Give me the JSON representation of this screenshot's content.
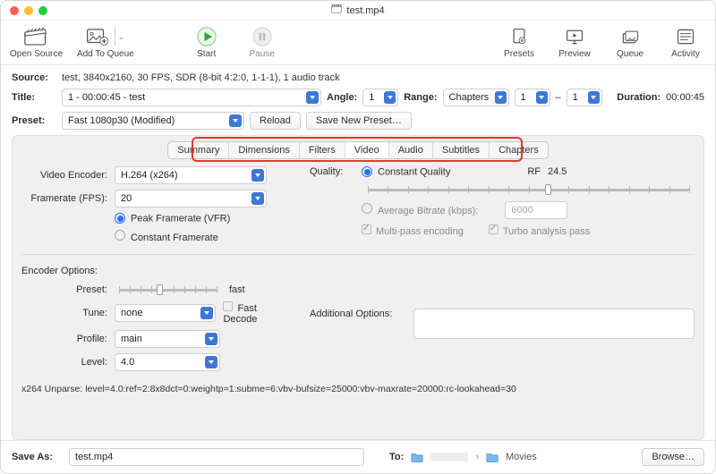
{
  "window": {
    "title": "test.mp4"
  },
  "toolbar": {
    "open_source": "Open Source",
    "add_to_queue": "Add To Queue",
    "start": "Start",
    "pause": "Pause",
    "presets": "Presets",
    "preview": "Preview",
    "queue": "Queue",
    "activity": "Activity"
  },
  "source": {
    "label": "Source:",
    "value": "test, 3840x2160, 30 FPS, SDR (8-bit 4:2:0, 1-1-1), 1 audio track"
  },
  "title_row": {
    "label": "Title:",
    "value": "1 - 00:00:45 - test",
    "angle_label": "Angle:",
    "angle": "1",
    "range_label": "Range:",
    "range_mode": "Chapters",
    "range_from": "1",
    "range_dash": "–",
    "range_to": "1",
    "duration_label": "Duration:",
    "duration": "00:00:45"
  },
  "preset_row": {
    "label": "Preset:",
    "value": "Fast 1080p30 (Modified)",
    "reload": "Reload",
    "save_new": "Save New Preset…"
  },
  "tabs": {
    "items": [
      "Summary",
      "Dimensions",
      "Filters",
      "Video",
      "Audio",
      "Subtitles",
      "Chapters"
    ],
    "active_index": 3
  },
  "video": {
    "encoder_label": "Video Encoder:",
    "encoder": "H.264 (x264)",
    "fps_label": "Framerate (FPS):",
    "fps": "20",
    "peak": "Peak Framerate (VFR)",
    "constant": "Constant Framerate",
    "quality_label": "Quality:",
    "cq": "Constant Quality",
    "rf_label": "RF",
    "rf_value": "24.5",
    "avg_bitrate": "Average Bitrate (kbps):",
    "bitrate_value": "6000",
    "multi_pass": "Multi-pass encoding",
    "turbo": "Turbo analysis pass"
  },
  "enc_opts": {
    "header": "Encoder Options:",
    "preset_label": "Preset:",
    "preset_value": "fast",
    "tune_label": "Tune:",
    "tune": "none",
    "fast_decode": "Fast Decode",
    "profile_label": "Profile:",
    "profile": "main",
    "addl_label": "Additional Options:",
    "level_label": "Level:",
    "level": "4.0"
  },
  "unparse": "x264 Unparse: level=4.0:ref=2:8x8dct=0:weightp=1:subme=6:vbv-bufsize=25000:vbv-maxrate=20000:rc-lookahead=30",
  "save": {
    "label": "Save As:",
    "filename": "test.mp4",
    "to_label": "To:",
    "path_sep": "›",
    "path_folder": "Movies",
    "browse": "Browse…"
  }
}
